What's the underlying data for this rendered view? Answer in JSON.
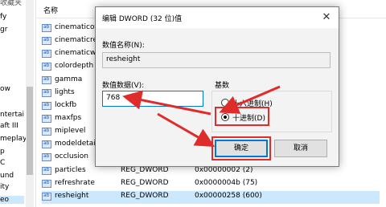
{
  "top_label": "收藏夹",
  "tree": {
    "items": [
      "fy",
      "gr",
      "ow",
      "ntertai",
      "aft III",
      "meplay",
      "p",
      "C",
      "und",
      "ity",
      "eo"
    ]
  },
  "list": {
    "col_name": "名称",
    "rows": [
      {
        "name": "cinematicov",
        "type": "",
        "value": ""
      },
      {
        "name": "cinematicre",
        "type": "",
        "value": ""
      },
      {
        "name": "cinematicwi",
        "type": "",
        "value": ""
      },
      {
        "name": "colordepth",
        "type": "",
        "value": ""
      },
      {
        "name": "gamma",
        "type": "",
        "value": ""
      },
      {
        "name": "lights",
        "type": "",
        "value": ""
      },
      {
        "name": "lockfb",
        "type": "",
        "value": ""
      },
      {
        "name": "maxfps",
        "type": "",
        "value": ""
      },
      {
        "name": "miplevel",
        "type": "",
        "value": ""
      },
      {
        "name": "modeldetail",
        "type": "",
        "value": ""
      },
      {
        "name": "occlusion",
        "type": "",
        "value": ""
      },
      {
        "name": "particles",
        "type": "REG_DWORD",
        "value": "0x00000002 (2)"
      },
      {
        "name": "refreshrate",
        "type": "REG_DWORD",
        "value": "0x0000004b (75)"
      },
      {
        "name": "resheight",
        "type": "REG_DWORD",
        "value": "0x00000258 (600)"
      }
    ]
  },
  "dialog": {
    "title": "编辑 DWORD (32 位)值",
    "close": "✕",
    "value_name_label": "数值名称(N):",
    "value_name": "resheight",
    "value_data_label": "数值数据(V):",
    "value_data": "768",
    "base_label": "基数",
    "hex_label": "十六进制(H)",
    "dec_label": "十进制(D)",
    "ok": "确定",
    "cancel": "取消"
  },
  "colors": {
    "highlight": "#e02b2b",
    "default_button_border": "#0078d7",
    "selection": "#cce8ff"
  }
}
